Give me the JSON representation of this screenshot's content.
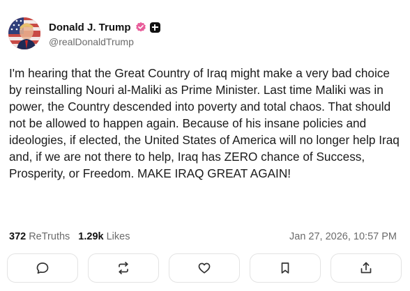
{
  "author": {
    "display_name": "Donald J. Trump",
    "handle": "@realDonaldTrump",
    "verified": true,
    "badge_color": "#e85d9a"
  },
  "post": {
    "text": "I'm hearing that the Great Country of Iraq might make a very bad choice by reinstalling Nouri al-Maliki as Prime Minister. Last time Maliki was in power, the Country descended into poverty and total chaos. That should not be allowed to happen again. Because of his insane policies and ideologies, if elected, the United States of America will no longer help Iraq and, if we are not there to help, Iraq has ZERO chance of Success, Prosperity, or Freedom. MAKE IRAQ GREAT AGAIN!"
  },
  "stats": {
    "retruths_count": "372",
    "retruths_label": "ReTruths",
    "likes_count": "1.29k",
    "likes_label": "Likes",
    "timestamp": "Jan 27, 2026, 10:57 PM"
  },
  "actions": [
    {
      "icon": "reply-icon"
    },
    {
      "icon": "retruth-icon"
    },
    {
      "icon": "like-icon"
    },
    {
      "icon": "bookmark-icon"
    },
    {
      "icon": "share-icon"
    }
  ]
}
